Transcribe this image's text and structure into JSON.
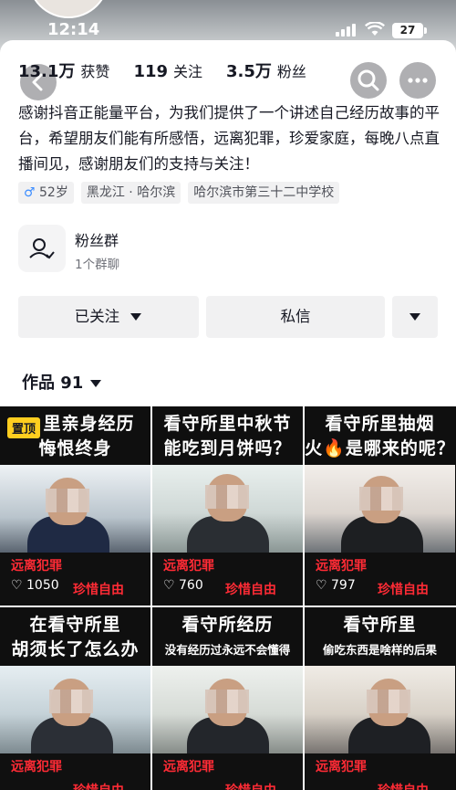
{
  "status": {
    "time": "12:14",
    "battery": "27"
  },
  "icons": {
    "back": "chevron-left-icon",
    "search": "search-icon",
    "more": "more-dots-icon",
    "fan_group": "group-icon",
    "heart": "heart-icon",
    "caret": "caret-down-icon"
  },
  "stats": [
    {
      "value": "13.1万",
      "label": "获赞"
    },
    {
      "value": "119",
      "label": "关注"
    },
    {
      "value": "3.5万",
      "label": "粉丝"
    }
  ],
  "bio": "感谢抖音正能量平台，为我们提供了一个讲述自己经历故事的平台，希望朋友们能有所感悟，远离犯罪，珍爱家庭，每晚八点直播间见，感谢朋友们的支持与关注！",
  "tags": {
    "age": "52岁",
    "location": "黑龙江 · 哈尔滨",
    "school": "哈尔滨市第三十二中学校"
  },
  "fan_group": {
    "title": "粉丝群",
    "subtitle": "1个群聊"
  },
  "actions": {
    "follow": "已关注",
    "message": "私信"
  },
  "works": {
    "label": "作品",
    "count": "91"
  },
  "videos": [
    {
      "caption_line1": "里亲身经历",
      "caption_line2": "悔恨终身",
      "pinned": "置顶",
      "likes": "1050",
      "red_text_1": "远离犯罪",
      "red_text_2": "珍惜自由"
    },
    {
      "caption_line1": "看守所里中秋节",
      "caption_line2": "能吃到月饼吗？",
      "likes": "760",
      "red_text_1": "远离犯罪",
      "red_text_2": "珍惜自由"
    },
    {
      "caption_line1": "看守所里抽烟",
      "caption_line2": "火🔥是哪来的呢？",
      "likes": "797",
      "red_text_1": "远离犯罪",
      "red_text_2": "珍惜自由"
    },
    {
      "caption_line1": "在看守所里",
      "caption_line2": "胡须长了怎么办",
      "likes": "",
      "red_text_1": "远离犯罪",
      "red_text_2": "珍惜自由"
    },
    {
      "caption_line1": "看守所经历",
      "caption_line2": "没有经历过永远不会懂得",
      "likes": "",
      "red_text_1": "远离犯罪",
      "red_text_2": "珍惜自由"
    },
    {
      "caption_line1": "看守所里",
      "caption_line2": "偷吃东西是啥样的后果",
      "likes": "",
      "red_text_1": "远离犯罪",
      "red_text_2": "珍惜自由"
    }
  ],
  "colors": {
    "accent_red": "#ff2b35",
    "pin_yellow": "#ffce1f",
    "button_bg": "#f1f1f2"
  }
}
